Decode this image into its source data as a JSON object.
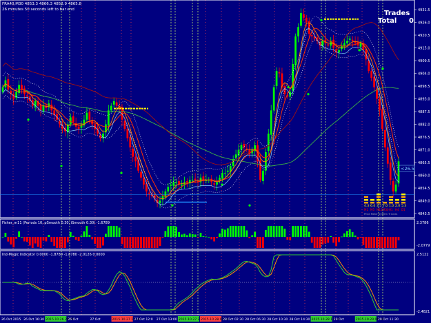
{
  "colors": {
    "background": "#000080",
    "frame": "#ffffff",
    "bull": "#00ff00",
    "bear": "#ff0000",
    "ma_red": "#ff3000",
    "ma_orange": "#ff7f00",
    "ma_brown": "#a01010",
    "ma_green": "#3cb043",
    "env_dotted": "#ffffff",
    "fisher_pos": "#00ff00",
    "fisher_neg": "#ff0000",
    "magic_line1": "#32cd32",
    "magic_line2": "#ff8c00",
    "vline_green": "#b7e36b",
    "vline_red": "#ff4040",
    "hline_blue": "#1e90ff",
    "yellow": "#ffff00"
  },
  "header": {
    "symbol_line": "FRA40,M30  4853.3 4866.3 4852.9 4865.8",
    "timer_line": "26 minutes 50 seconds left to bar end"
  },
  "trades_box": {
    "trades_label": "Trades",
    "total_label": "Total",
    "total_value": "0"
  },
  "price_axis": {
    "ticks": [
      "4931.5",
      "4926.0",
      "4920.5",
      "4915.0",
      "4909.5",
      "4904.0",
      "4898.5",
      "4893.0",
      "4887.5",
      "4882.0",
      "4876.5",
      "4871.0",
      "4865.5",
      "4860.0",
      "4854.5",
      "4849.0",
      "4843.5"
    ],
    "price_marker": "<26.5"
  },
  "fisher_panel": {
    "label": "Fisher_m11 (Periods 10, pSmooth 0.30, iSmooth 0.30)  -1.6789",
    "max_label": "2.3786",
    "min_label": "-2.0779"
  },
  "magic_panel": {
    "label": "Ind-Magic Indicator 0.0000 -1.8780 -1.8780 -2.0126 0.0000",
    "max_label": "2.5122",
    "min_label": "-2.4821"
  },
  "mini_table": {
    "values_row": [
      "4.3",
      "6.4",
      "3.5",
      "7.0",
      "1.0",
      "2.0",
      "5.3"
    ],
    "names_row": [
      "M1",
      "M5",
      "M15",
      "M30",
      "H1",
      "H4",
      "D1"
    ],
    "footer": "Price Meter System Tr Lines"
  },
  "time_axis": {
    "labels": [
      "26 Oct 2015",
      "26 Oct 16:30",
      "2015.10.26 20:00",
      "26 Oct",
      "27 Oct",
      "2015.10.27 11:00",
      "27 Oct 12:0",
      "27 Oct 13:00",
      "2015.10.27 20:00",
      "2015.10.28 02:00",
      "28 Oct 02:30",
      "28 Oct 06:30",
      "28 Oct 10:30",
      "28 Oct 14:30",
      "2015.10.28 17:00",
      "29 Oct",
      "2015.10.29 06:30",
      "29 Oct 11:30"
    ]
  },
  "chart_data": {
    "type": "candlestick",
    "symbol": "FRA40",
    "timeframe": "M30",
    "last_bar": {
      "open": 4853.3,
      "high": 4866.3,
      "low": 4852.9,
      "close": 4865.8
    },
    "ylim": [
      4843.5,
      4931.5
    ],
    "closes": [
      4898,
      4901,
      4897,
      4895,
      4893,
      4896,
      4899,
      4897,
      4895,
      4894,
      4892,
      4890,
      4892,
      4890,
      4888,
      4890,
      4889,
      4891,
      4888,
      4886,
      4884,
      4882,
      4880,
      4879,
      4882,
      4885,
      4883,
      4881,
      4880,
      4882,
      4884,
      4887,
      4884,
      4882,
      4880,
      4878,
      4876,
      4878,
      4882,
      4888,
      4890,
      4892,
      4890,
      4889,
      4884,
      4880,
      4876,
      4872,
      4868,
      4866,
      4862,
      4859,
      4856,
      4853,
      4852,
      4851,
      4850,
      4848,
      4849,
      4851,
      4853,
      4855,
      4856,
      4857,
      4857,
      4856,
      4856,
      4857,
      4857,
      4858,
      4858,
      4858,
      4857,
      4859,
      4858,
      4858,
      4858,
      4857,
      4856,
      4857,
      4859,
      4861,
      4861,
      4862,
      4864,
      4867,
      4869,
      4871,
      4873,
      4872,
      4871,
      4869,
      4871,
      4873,
      4866,
      4858,
      4862,
      4870,
      4878,
      4888,
      4898,
      4905,
      4904,
      4898,
      4895,
      4894,
      4896,
      4908,
      4920,
      4924,
      4930,
      4928,
      4926,
      4921,
      4920,
      4919,
      4918,
      4916,
      4918,
      4917,
      4916,
      4918,
      4915,
      4913,
      4914,
      4916,
      4917,
      4918,
      4919,
      4918,
      4917,
      4916,
      4917,
      4914,
      4910,
      4905,
      4902,
      4898,
      4893,
      4888,
      4880,
      4872,
      4865,
      4858,
      4853,
      4856,
      4866
    ]
  }
}
